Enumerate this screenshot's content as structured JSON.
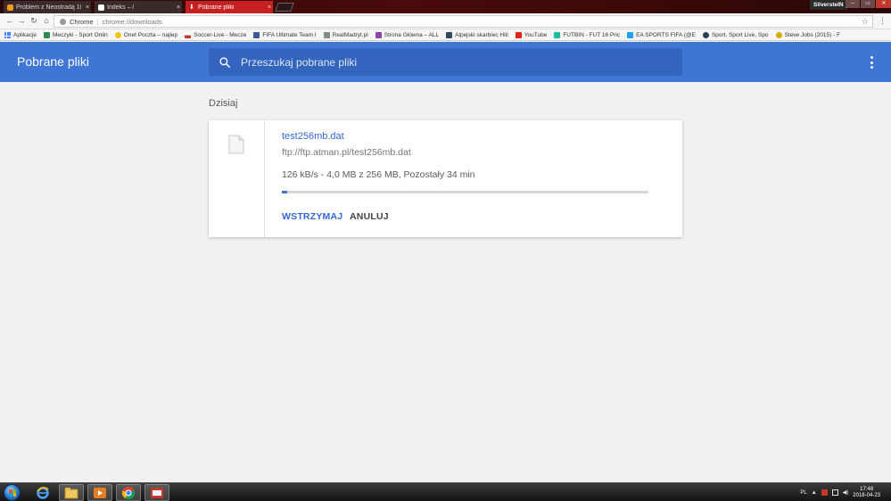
{
  "browser": {
    "tabs": [
      {
        "title": "Problem z Neostradą 10",
        "active": false,
        "favicon_color": "#f39c12"
      },
      {
        "title": "Indeks – /",
        "active": false,
        "favicon_color": "#ffffff"
      },
      {
        "title": "Pobrane pliki",
        "active": true,
        "favicon_color": "#ffffff"
      }
    ],
    "tab_close_glyph": "×",
    "profile_name": "SilversteIN",
    "window_buttons": {
      "minimize": "–",
      "maximize": "▭",
      "close": "✕"
    },
    "address": {
      "scheme_label": "Chrome",
      "separator": "|",
      "url": "chrome://downloads"
    },
    "bookmarks": [
      {
        "label": "Aplikacje",
        "icon_color": "#4285f4"
      },
      {
        "label": "Meczyki - Sport Onlin",
        "icon_color": "#2e8b57"
      },
      {
        "label": "Onet Poczta – najlep",
        "icon_color": "#f1c40f"
      },
      {
        "label": "Soccer-Live - Mecze",
        "icon_color": "#c0392b"
      },
      {
        "label": "FIFA Ultimate Team I",
        "icon_color": "#3b5998"
      },
      {
        "label": "RealMadryt.pl",
        "icon_color": "#7f8c8d"
      },
      {
        "label": "Strona Główna – ALL",
        "icon_color": "#8e44ad"
      },
      {
        "label": "Alpejski skarbiec Hitl",
        "icon_color": "#34495e"
      },
      {
        "label": "YouTube",
        "icon_color": "#e62117"
      },
      {
        "label": "FUTBIN - FUT 16 Pric",
        "icon_color": "#1abc9c"
      },
      {
        "label": "EA SPORTS FIFA (@E",
        "icon_color": "#1da1f2"
      },
      {
        "label": "Sport, Sport Live, Spo",
        "icon_color": "#2c3e50"
      },
      {
        "label": "Steve Jobs (2015) - F",
        "icon_color": "#d4ac0d"
      }
    ]
  },
  "page": {
    "title": "Pobrane pliki",
    "search": {
      "placeholder": "Przeszukaj pobrane pliki",
      "value": ""
    },
    "date_heading": "Dzisiaj",
    "downloads": [
      {
        "file_name": "test256mb.dat",
        "url": "ftp://ftp.atman.pl/test256mb.dat",
        "status": "126 kB/s - 4,0 MB z 256 MB, Pozostały 34 min",
        "progress_fraction": 0.0156,
        "pause_label": "WSTRZYMAJ",
        "cancel_label": "ANULUJ"
      }
    ]
  },
  "taskbar": {
    "language": "PL",
    "time": "17:48",
    "date": "2018-04-23"
  },
  "colors": {
    "appbar": "#3f76d6",
    "search_bg": "#3465be",
    "link_blue": "#3367d6",
    "tab_active": "#c62020"
  }
}
